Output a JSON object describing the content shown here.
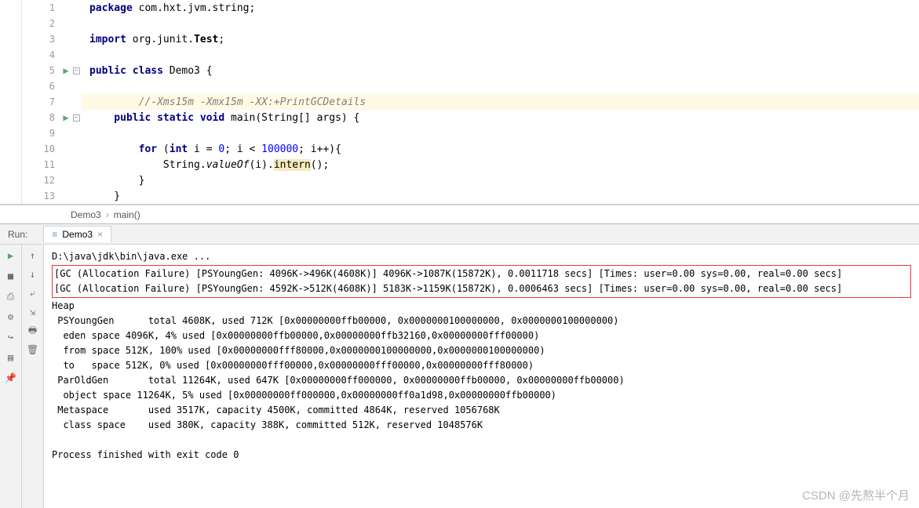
{
  "code": {
    "lines": [
      {
        "n": "1",
        "t": "package",
        "rest": " com.hxt.jvm.string;",
        "kw": true
      },
      {
        "n": "2",
        "t": "",
        "rest": ""
      },
      {
        "n": "3",
        "t": "import",
        "rest": " org.junit.",
        "tail": "Test",
        "after": ";",
        "kw": true,
        "bold_tail": true
      },
      {
        "n": "4",
        "t": "",
        "rest": ""
      },
      {
        "n": "5",
        "t": "public class",
        "rest": " Demo3 {",
        "kw": true,
        "run": true,
        "fold": true
      },
      {
        "n": "6",
        "t": "",
        "rest": ""
      },
      {
        "n": "7",
        "t": "",
        "rest": "",
        "comment": "        //-Xms15m -Xmx15m -XX:+PrintGCDetails",
        "hl": true
      },
      {
        "n": "8",
        "t": "    public static void",
        "rest": " main(String[] args) {",
        "kw": true,
        "run": true,
        "fold": true
      },
      {
        "n": "9",
        "t": "",
        "rest": ""
      },
      {
        "n": "10",
        "t": "        for",
        "rest": " (",
        "kw": true,
        "for_inner": true
      },
      {
        "n": "11",
        "t": "",
        "rest": "            String.",
        "ital": "valueOf",
        "after": "(i).",
        "warn": "intern",
        "after2": "();"
      },
      {
        "n": "12",
        "t": "",
        "rest": "        }"
      },
      {
        "n": "13",
        "t": "",
        "rest": "    }",
        "fold_end": true
      }
    ],
    "for_content": {
      "kw2": "int",
      "var": " i = ",
      "lit1": "0",
      "mid": "; i < ",
      "lit2": "100000",
      "end": "; i++){"
    }
  },
  "breadcrumb": {
    "a": "Demo3",
    "b": "main()"
  },
  "run": {
    "label": "Run:",
    "tab": "Demo3",
    "cmd": "D:\\java\\jdk\\bin\\java.exe ...",
    "gc1": "[GC (Allocation Failure) [PSYoungGen: 4096K->496K(4608K)] 4096K->1087K(15872K), 0.0011718 secs] [Times: user=0.00 sys=0.00, real=0.00 secs]",
    "gc2": "[GC (Allocation Failure) [PSYoungGen: 4592K->512K(4608K)] 5183K->1159K(15872K), 0.0006463 secs] [Times: user=0.00 sys=0.00, real=0.00 secs]",
    "heap": "Heap",
    "l1": " PSYoungGen      total 4608K, used 712K [0x00000000ffb00000, 0x0000000100000000, 0x0000000100000000)",
    "l2": "  eden space 4096K, 4% used [0x00000000ffb00000,0x00000000ffb32160,0x00000000fff00000)",
    "l3": "  from space 512K, 100% used [0x00000000fff80000,0x0000000100000000,0x0000000100000000)",
    "l4": "  to   space 512K, 0% used [0x00000000fff00000,0x00000000fff00000,0x00000000fff80000)",
    "l5": " ParOldGen       total 11264K, used 647K [0x00000000ff000000, 0x00000000ffb00000, 0x00000000ffb00000)",
    "l6": "  object space 11264K, 5% used [0x00000000ff000000,0x00000000ff0a1d98,0x00000000ffb00000)",
    "l7": " Metaspace       used 3517K, capacity 4500K, committed 4864K, reserved 1056768K",
    "l8": "  class space    used 380K, capacity 388K, committed 512K, reserved 1048576K",
    "exit": "Process finished with exit code 0"
  },
  "watermark": "CSDN @先熬半个月"
}
